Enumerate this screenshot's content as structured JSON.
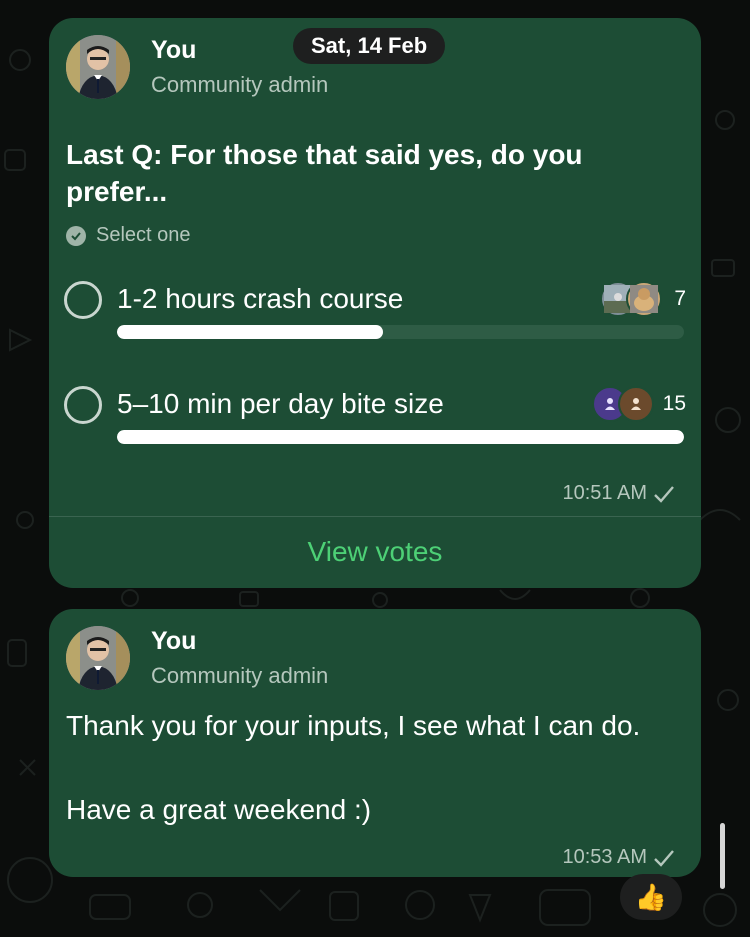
{
  "date_separator": "Sat, 14 Feb",
  "poll_message": {
    "sender": "You",
    "role": "Community admin",
    "question": "Last Q: For those that said yes, do you prefer...",
    "select_hint": "Select one",
    "options": [
      {
        "label": "1-2 hours crash course",
        "votes": "7",
        "fraction": 0.47
      },
      {
        "label": "5–10 min per day bite size",
        "votes": "15",
        "fraction": 1.0
      }
    ],
    "time": "10:51 AM",
    "view_votes": "View votes"
  },
  "text_message": {
    "sender": "You",
    "role": "Community admin",
    "text": "Thank you for your inputs, I see what I can do.\n\nHave a great weekend :)",
    "time": "10:53 AM"
  },
  "reaction": "👍",
  "icons": {
    "avatar": "user-avatar",
    "read_tick": "check-icon",
    "select": "check-circle-icon",
    "voter": "person-icon"
  },
  "colors": {
    "bubble": "#1d4d35",
    "accent": "#4dd076",
    "background": "#0b0d0c"
  }
}
